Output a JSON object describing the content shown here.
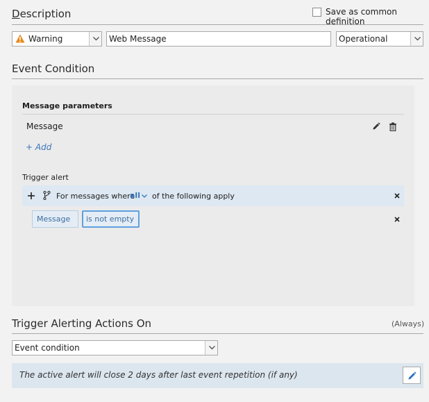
{
  "description": {
    "title": "Description",
    "save_common_label": "Save as common definition",
    "severity_value": "Warning",
    "name_value": "Web Message",
    "category_value": "Operational"
  },
  "event_condition": {
    "title": "Event Condition",
    "message_params_header": "Message parameters",
    "message_param_name": "Message",
    "add_label": "+ Add",
    "trigger_alert_label": "Trigger alert",
    "rule_prefix": "For messages where",
    "rule_quantifier": "all",
    "rule_suffix": "of the following apply",
    "condition_field": "Message",
    "condition_operator": "is not empty"
  },
  "trigger_actions": {
    "title": "Trigger Alerting Actions On",
    "mode_note": "(Always)",
    "select_value": "Event condition",
    "close_info": "The active alert will close 2 days after last event repetition (if any)"
  },
  "colors": {
    "warning": "#e8891c",
    "accent_blue": "#3a75b8",
    "pencil_blue": "#2a73c4"
  }
}
